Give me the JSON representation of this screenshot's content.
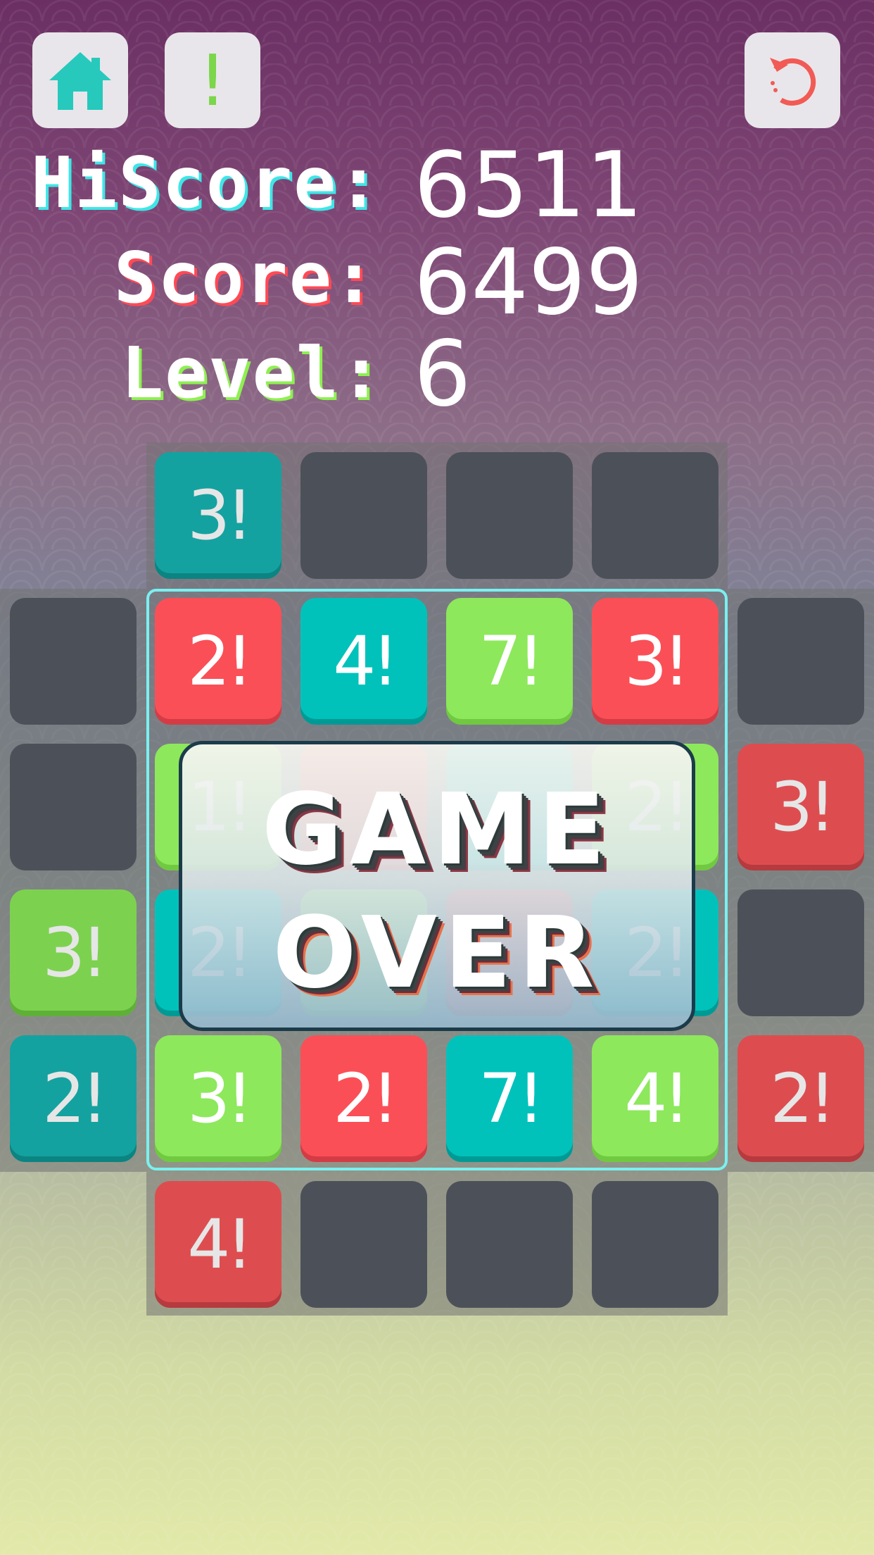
{
  "header": {
    "home_icon": "home-icon",
    "hint_label": "!",
    "restart_icon": "restart-icon"
  },
  "scores": {
    "hiscore_label": "HiScore:",
    "hiscore_value": "6511",
    "score_label": "Score:",
    "score_value": "6499",
    "level_label": "Level:",
    "level_value": "6"
  },
  "colors": {
    "hiscore_accent": "#3ee6e6",
    "score_accent": "#ff4a56",
    "level_accent": "#8ef050",
    "tile_red": "#fb4f57",
    "tile_green": "#8de85c",
    "tile_teal": "#00c2bb",
    "empty_cell": "#4c5159"
  },
  "board": {
    "top_pieces": [
      "3!",
      "",
      "",
      ""
    ],
    "left_pieces": [
      "",
      "",
      "3!",
      "2!"
    ],
    "right_pieces": [
      "",
      "3!",
      "",
      "2!"
    ],
    "bottom_pieces": [
      "4!",
      "",
      "",
      ""
    ],
    "grid_rows": [
      [
        "2!",
        "4!",
        "7!",
        "3!"
      ],
      [
        "1!",
        "",
        "",
        "2!"
      ],
      [
        "2!",
        "",
        "",
        "2!"
      ],
      [
        "3!",
        "2!",
        "7!",
        "4!"
      ]
    ]
  },
  "overlay": {
    "line1": "GAME",
    "line2": "OVER"
  }
}
